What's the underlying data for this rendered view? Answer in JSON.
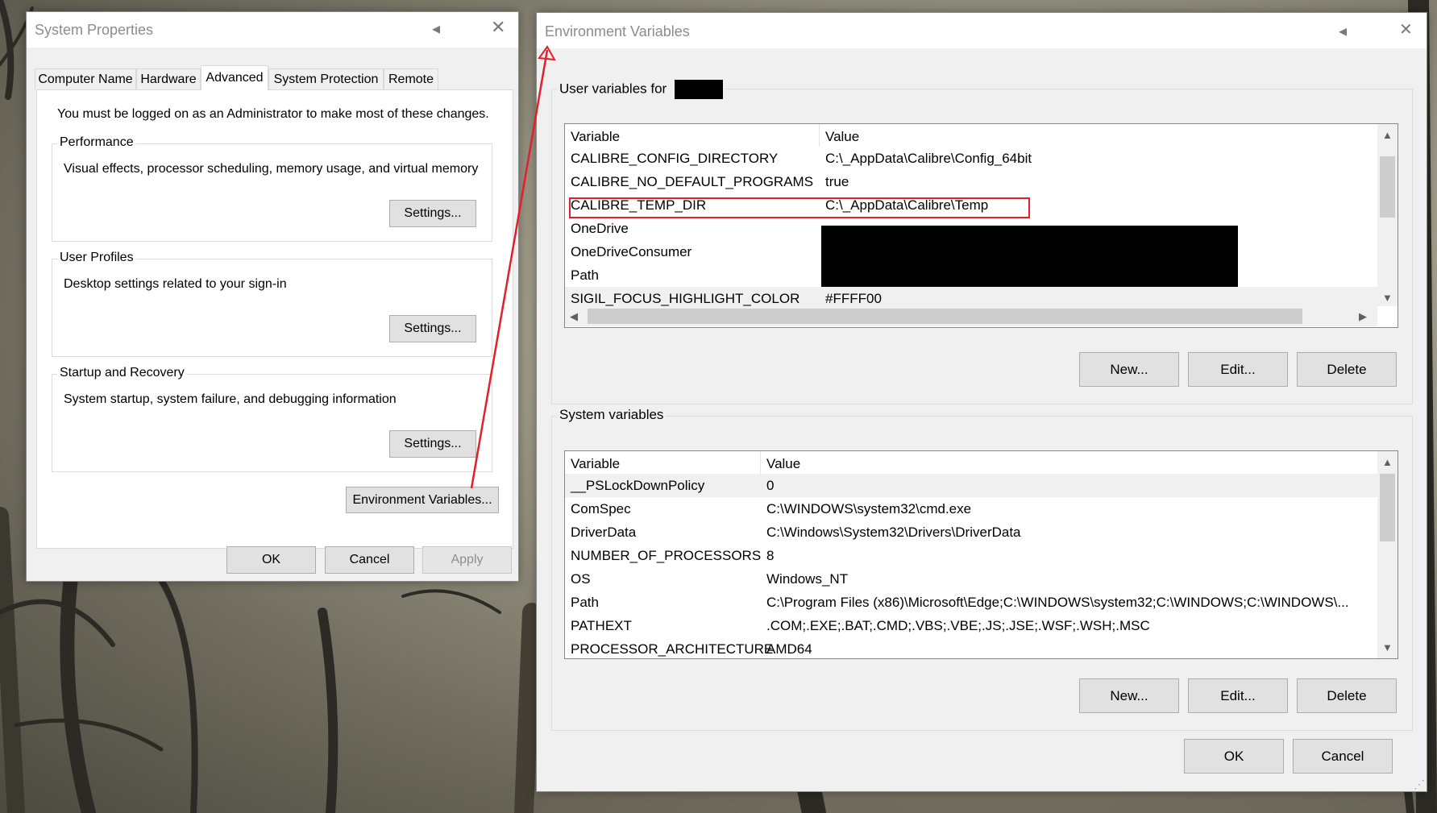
{
  "colors": {
    "accent_red": "#e0202a",
    "window_bg": "#f0f0f0",
    "title_text": "#8c8c8c"
  },
  "sysprops": {
    "title": "System Properties",
    "tabs": [
      "Computer Name",
      "Hardware",
      "Advanced",
      "System Protection",
      "Remote"
    ],
    "admin_note": "You must be logged on as an Administrator to make most of these changes.",
    "performance": {
      "label": "Performance",
      "desc": "Visual effects, processor scheduling, memory usage, and virtual memory",
      "button": "Settings..."
    },
    "profiles": {
      "label": "User Profiles",
      "desc": "Desktop settings related to your sign-in",
      "button": "Settings..."
    },
    "startup": {
      "label": "Startup and Recovery",
      "desc": "System startup, system failure, and debugging information",
      "button": "Settings..."
    },
    "env_button": "Environment Variables...",
    "ok": "OK",
    "cancel": "Cancel",
    "apply": "Apply"
  },
  "envvars": {
    "title": "Environment Variables",
    "user_label": "User variables for",
    "user_header": {
      "variable": "Variable",
      "value": "Value"
    },
    "user_rows": [
      {
        "name": "CALIBRE_CONFIG_DIRECTORY",
        "value": "C:\\_AppData\\Calibre\\Config_64bit"
      },
      {
        "name": "CALIBRE_NO_DEFAULT_PROGRAMS",
        "value": "true"
      },
      {
        "name": "CALIBRE_TEMP_DIR",
        "value": "C:\\_AppData\\Calibre\\Temp"
      },
      {
        "name": "OneDrive",
        "value": ""
      },
      {
        "name": "OneDriveConsumer",
        "value": ""
      },
      {
        "name": "Path",
        "value": ""
      },
      {
        "name": "SIGIL_FOCUS_HIGHLIGHT_COLOR",
        "value": "#FFFF00"
      }
    ],
    "user_new": "New...",
    "user_edit": "Edit...",
    "user_delete": "Delete",
    "system_label": "System variables",
    "system_header": {
      "variable": "Variable",
      "value": "Value"
    },
    "system_rows": [
      {
        "name": "__PSLockDownPolicy",
        "value": "0"
      },
      {
        "name": "ComSpec",
        "value": "C:\\WINDOWS\\system32\\cmd.exe"
      },
      {
        "name": "DriverData",
        "value": "C:\\Windows\\System32\\Drivers\\DriverData"
      },
      {
        "name": "NUMBER_OF_PROCESSORS",
        "value": "8"
      },
      {
        "name": "OS",
        "value": "Windows_NT"
      },
      {
        "name": "Path",
        "value": "C:\\Program Files (x86)\\Microsoft\\Edge;C:\\WINDOWS\\system32;C:\\WINDOWS;C:\\WINDOWS\\..."
      },
      {
        "name": "PATHEXT",
        "value": ".COM;.EXE;.BAT;.CMD;.VBS;.VBE;.JS;.JSE;.WSF;.WSH;.MSC"
      },
      {
        "name": "PROCESSOR_ARCHITECTURE",
        "value": "AMD64"
      }
    ],
    "sys_new": "New...",
    "sys_edit": "Edit...",
    "sys_delete": "Delete",
    "ok": "OK",
    "cancel": "Cancel"
  }
}
